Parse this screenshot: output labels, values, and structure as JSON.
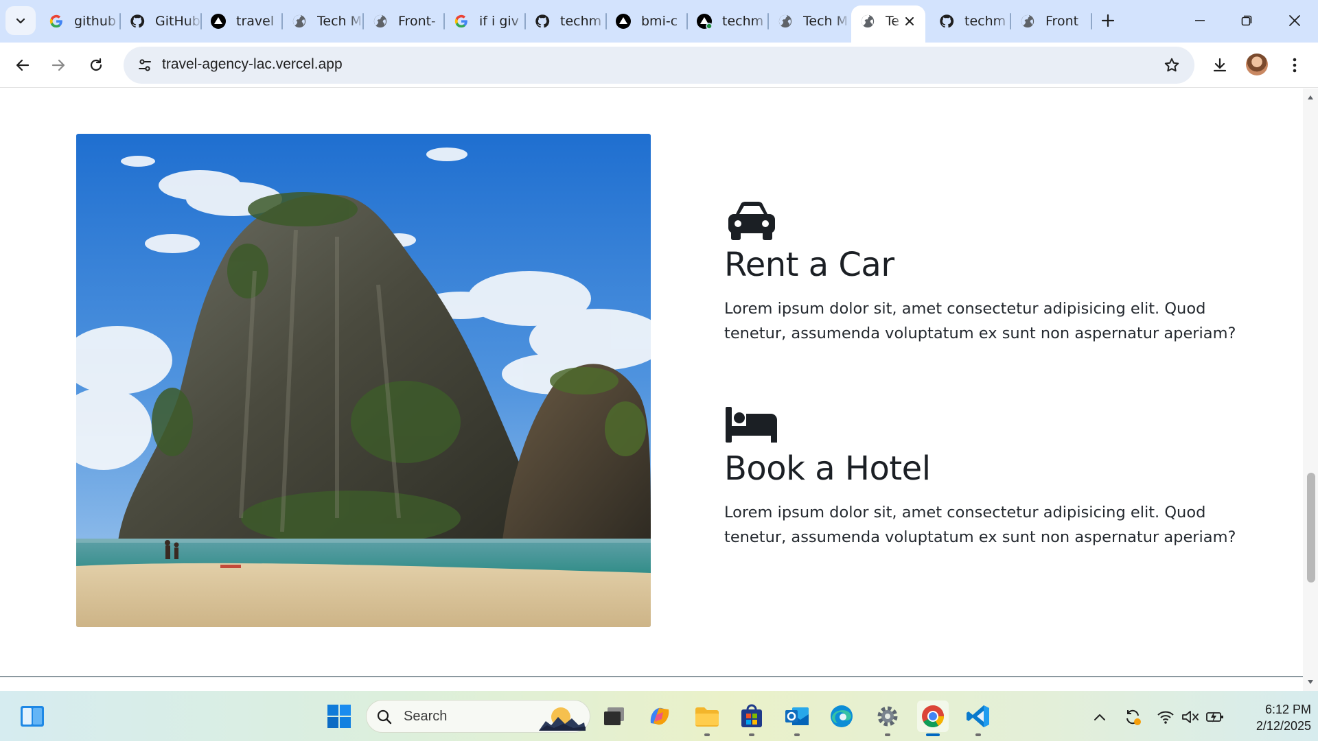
{
  "browser": {
    "tabs": [
      {
        "title": "github",
        "icon": "google-icon"
      },
      {
        "title": "GitHub",
        "icon": "github-icon"
      },
      {
        "title": "travel",
        "icon": "vercel-icon"
      },
      {
        "title": "Tech M",
        "icon": "globe-icon"
      },
      {
        "title": "Front-",
        "icon": "globe-icon"
      },
      {
        "title": "if i giv",
        "icon": "google-icon"
      },
      {
        "title": "techm",
        "icon": "github-icon"
      },
      {
        "title": "bmi-c",
        "icon": "vercel-icon"
      },
      {
        "title": "techm",
        "icon": "vercel-icon"
      },
      {
        "title": "Tech M",
        "icon": "globe-icon"
      },
      {
        "title": "Te",
        "icon": "globe-icon",
        "active": true
      },
      {
        "title": "techm",
        "icon": "github-icon"
      },
      {
        "title": "Front",
        "icon": "globe-icon"
      }
    ],
    "address": "travel-agency-lac.vercel.app"
  },
  "page": {
    "features": [
      {
        "icon": "car-icon",
        "title": "Rent a Car",
        "text": "Lorem ipsum dolor sit, amet consectetur adipisicing elit. Quod tenetur, assumenda voluptatum ex sunt non aspernatur aperiam?"
      },
      {
        "icon": "bed-icon",
        "title": "Book a Hotel",
        "text": "Lorem ipsum dolor sit, amet consectetur adipisicing elit. Quod tenetur, assumenda voluptatum ex sunt non aspernatur aperiam?"
      }
    ],
    "image_subject": "limestone-cliff-beach-photo"
  },
  "taskbar": {
    "search_placeholder": "Search",
    "time": "6:12 PM",
    "date": "2/12/2025"
  },
  "colors": {
    "tabstrip": "#d3e3fd",
    "footer": "#132d3b",
    "text": "#1b1f24"
  }
}
